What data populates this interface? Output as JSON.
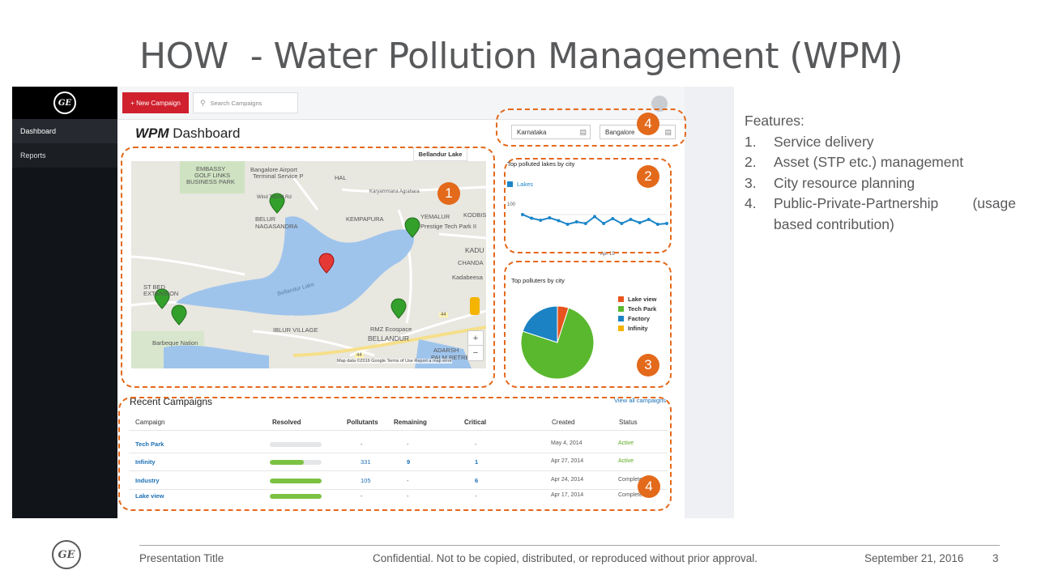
{
  "slide": {
    "title": "HOW  - Water Pollution Management (WPM)"
  },
  "sidebar": {
    "logo": "GE",
    "items": [
      {
        "label": "Dashboard"
      },
      {
        "label": "Reports"
      }
    ]
  },
  "topbar": {
    "new_campaign_label": "+ New Campaign",
    "search_placeholder": "Search Campaigns"
  },
  "dashboard": {
    "title_prefix": "WPM",
    "title_suffix": " Dashboard",
    "state_select": "Karnataka",
    "city_select": "Bangalore"
  },
  "map": {
    "selected_lake": "Bellandur Lake",
    "labels": {
      "embassy": "EMBASSY",
      "golf": "GOLF LINKS",
      "business_park": "BUSINESS PARK",
      "airport1": "Bangalore Airport",
      "airport2": "Terminal Service P",
      "hal": "HAL",
      "karyammana": "Karyammana Agrahara",
      "windtunnel": "Wind Tunnel Rd",
      "belur1": "BELUR",
      "belur2": "NAGASANDRA",
      "kempapura": "KEMPAPURA",
      "yemalur": "YEMALUR",
      "prestige": "Prestige Tech Park II",
      "kodbis": "KODBIS",
      "kadu": "KADU",
      "chandal": "CHANDA",
      "kadabeesa": "Kadabeesa",
      "lake_name": "Bellandur Lake",
      "st_bed1": "ST BED",
      "st_bed2": "EXTENSION",
      "iblur": "IBLUR VILLAGE",
      "rmz": "RMZ Ecospace",
      "bellandur": "BELLANDUR",
      "barbeque": "Barbeque Nation",
      "adarsh1": "ADARSH",
      "adarsh2": "PALM RETREA",
      "road44": "44",
      "road44b": "44"
    },
    "zoom_in": "+",
    "zoom_out": "−",
    "attribution": "Map data ©2016 Google   Terms of Use   Report a map error"
  },
  "lakes_chart": {
    "chart_data": {
      "type": "line",
      "title": "Top polluted lakes by city",
      "series": [
        {
          "name": "Lakes",
          "values": [
            100,
            91,
            86,
            92,
            85,
            76,
            82,
            78,
            95,
            78,
            90,
            78,
            88,
            80,
            88,
            76,
            78
          ]
        }
      ],
      "tick_y": "100",
      "tick_x": "Apr 15",
      "ylim": [
        0,
        160
      ],
      "color": "#1b86c8"
    }
  },
  "polluters_chart": {
    "chart_data": {
      "type": "pie",
      "title": "Top polluters by city",
      "slices": [
        {
          "name": "Lake view",
          "value": 5,
          "color": "#e8541d"
        },
        {
          "name": "Tech Park",
          "value": 75,
          "color": "#5ab82e"
        },
        {
          "name": "Factory",
          "value": 20,
          "color": "#1b82c4"
        },
        {
          "name": "Infinity",
          "value": 0,
          "color": "#f4b400"
        }
      ]
    }
  },
  "campaigns": {
    "title": "Recent Campaigns",
    "view_all": "View all campaigns",
    "headers": [
      "Campaign",
      "Resolved",
      "Pollutants",
      "Remaining",
      "Critical",
      "Created",
      "Status"
    ],
    "rows": [
      {
        "name": "Tech Park",
        "resolved": 0,
        "pollutants": "-",
        "remaining": "-",
        "critical": "-",
        "created": "May 4, 2014",
        "status": "Active"
      },
      {
        "name": "Infinity",
        "resolved": 0.65,
        "pollutants": "331",
        "remaining": "9",
        "critical": "1",
        "created": "Apr 27, 2014",
        "status": "Active"
      },
      {
        "name": "Industry",
        "resolved": 1,
        "pollutants": "105",
        "remaining": "-",
        "critical": "6",
        "created": "Apr 24, 2014",
        "status": "Complete"
      },
      {
        "name": "Lake view",
        "resolved": 1,
        "pollutants": "-",
        "remaining": "-",
        "critical": "-",
        "created": "Apr 17, 2014",
        "status": "Complete"
      }
    ]
  },
  "badges": [
    "1",
    "2",
    "3",
    "4",
    "4"
  ],
  "features": {
    "heading": "Features:",
    "items": [
      {
        "num": "1.",
        "text": "Service delivery"
      },
      {
        "num": "2.",
        "text": "Asset (STP etc.) management"
      },
      {
        "num": "3.",
        "text": "City resource planning"
      },
      {
        "num": "4.",
        "text": "Public-Private-Partnership  (usage based contribution)"
      }
    ]
  },
  "footer": {
    "logo": "GE",
    "presentation_title": "Presentation Title",
    "confidential": "Confidential. Not to be copied, distributed, or reproduced without prior approval.",
    "date": "September 21, 2016",
    "page": "3"
  },
  "colors": {
    "accent_orange": "#e3691b",
    "brand_red": "#d0202e",
    "link_blue": "#1b6fb5",
    "progress_green": "#7cc242"
  }
}
